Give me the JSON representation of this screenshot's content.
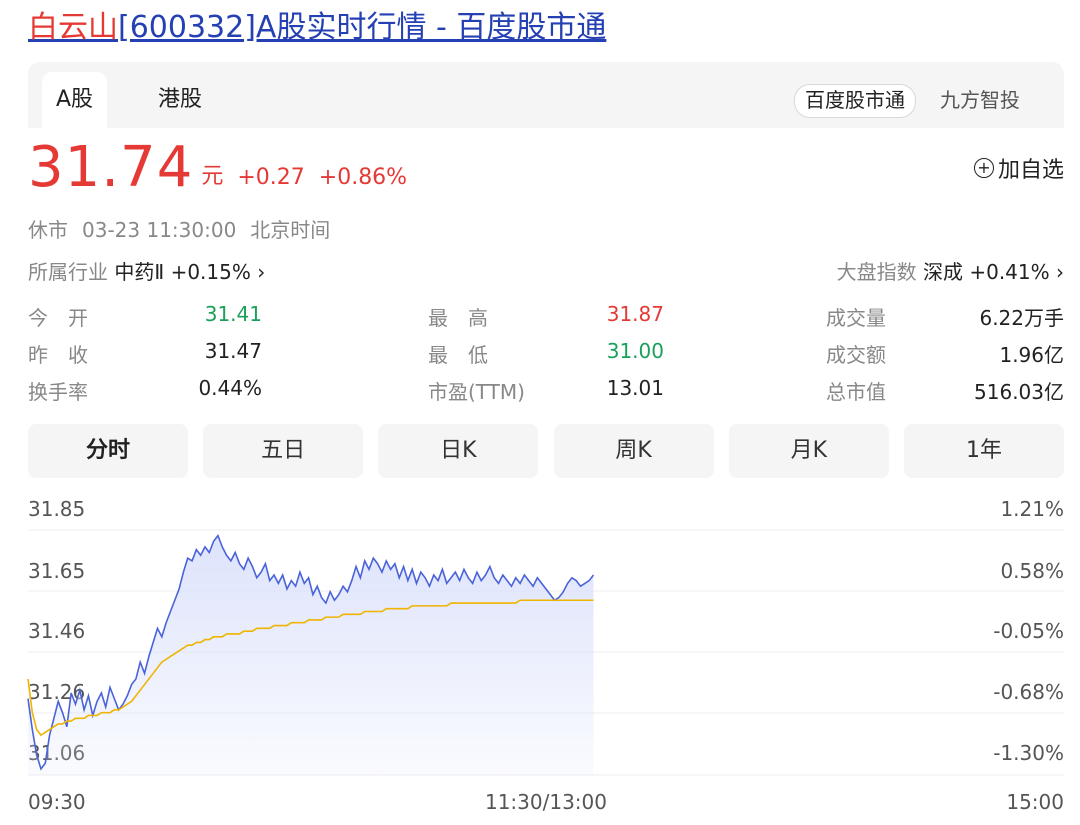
{
  "page": {
    "title_highlight": "白云山",
    "title_rest": "[600332]A股实时行情 - 百度股市通"
  },
  "tabs": {
    "a_share": "A股",
    "hk_share": "港股"
  },
  "sources": {
    "active": "百度股市通",
    "other": "九方智投"
  },
  "quote": {
    "price": "31.74",
    "unit": "元",
    "change": "+0.27",
    "change_pct": "+0.86%",
    "add_watchlist": "加自选",
    "status": "休市",
    "datetime": "03-23 11:30:00",
    "timezone": "北京时间"
  },
  "industry": {
    "label": "所属行业",
    "name": "中药Ⅱ",
    "change": "+0.15%",
    "arrow": "›"
  },
  "market_index": {
    "label": "大盘指数",
    "name": "深成",
    "change": "+0.41%",
    "arrow": "›"
  },
  "stats": [
    [
      {
        "label": "今　开",
        "value": "31.41",
        "color": "green"
      },
      {
        "label": "最　高",
        "value": "31.87",
        "color": "red"
      },
      {
        "label": "成交量",
        "value": "6.22万手",
        "color": "normal"
      }
    ],
    [
      {
        "label": "昨　收",
        "value": "31.47",
        "color": "normal"
      },
      {
        "label": "最　低",
        "value": "31.00",
        "color": "green"
      },
      {
        "label": "成交额",
        "value": "1.96亿",
        "color": "normal"
      }
    ],
    [
      {
        "label": "换手率",
        "value": "0.44%",
        "color": "normal"
      },
      {
        "label": "市盈(TTM)",
        "value": "13.01",
        "color": "normal"
      },
      {
        "label": "总市值",
        "value": "516.03亿",
        "color": "normal"
      }
    ]
  ],
  "period_tabs": [
    "分时",
    "五日",
    "日K",
    "周K",
    "月K",
    "1年"
  ],
  "active_period": 0,
  "colors": {
    "up": "#e53935",
    "down": "#1aa05a",
    "price_line": "#4a63d9",
    "avg_line": "#f0b400",
    "area_fill": "#dde3fb"
  },
  "chart_data": {
    "type": "line",
    "y_ticks": [
      "31.85",
      "31.65",
      "31.46",
      "31.26",
      "31.06"
    ],
    "y_pct_ticks": [
      "1.21%",
      "0.58%",
      "-0.05%",
      "-0.68%",
      "-1.30%"
    ],
    "x_ticks": [
      "09:30",
      "11:30/13:00",
      "15:00"
    ],
    "ylim": [
      31.06,
      31.85
    ],
    "minutes_total": 240,
    "series": [
      {
        "key": "price",
        "values": [
          31.25,
          31.14,
          31.05,
          31.0,
          31.02,
          31.12,
          31.18,
          31.24,
          31.2,
          31.15,
          31.27,
          31.23,
          31.28,
          31.21,
          31.26,
          31.19,
          31.24,
          31.27,
          31.22,
          31.29,
          31.25,
          31.21,
          31.23,
          31.26,
          31.3,
          31.32,
          31.38,
          31.34,
          31.4,
          31.45,
          31.5,
          31.47,
          31.52,
          31.56,
          31.6,
          31.64,
          31.7,
          31.75,
          31.74,
          31.78,
          31.76,
          31.79,
          31.77,
          31.81,
          31.83,
          31.79,
          31.76,
          31.74,
          31.77,
          31.73,
          31.71,
          31.75,
          31.72,
          31.68,
          31.7,
          31.73,
          31.67,
          31.69,
          31.66,
          31.69,
          31.64,
          31.67,
          31.65,
          31.7,
          31.66,
          31.68,
          31.62,
          31.65,
          31.61,
          31.59,
          31.63,
          31.6,
          31.62,
          31.65,
          31.63,
          31.67,
          31.72,
          31.68,
          31.74,
          31.71,
          31.75,
          31.73,
          31.7,
          31.74,
          31.71,
          31.73,
          31.68,
          31.72,
          31.67,
          31.71,
          31.66,
          31.7,
          31.68,
          31.65,
          31.69,
          31.67,
          31.71,
          31.66,
          31.68,
          31.7,
          31.67,
          31.71,
          31.68,
          31.66,
          31.7,
          31.67,
          31.69,
          31.72,
          31.68,
          31.66,
          31.69,
          31.67,
          31.65,
          31.68,
          31.66,
          31.69,
          31.67,
          31.65,
          31.68,
          31.66,
          31.64,
          31.62,
          31.6,
          31.61,
          31.63,
          31.66,
          31.68,
          31.67,
          31.65,
          31.66,
          31.67,
          31.69
        ]
      },
      {
        "key": "average",
        "values": [
          31.32,
          31.2,
          31.14,
          31.12,
          31.13,
          31.14,
          31.15,
          31.16,
          31.16,
          31.17,
          31.17,
          31.18,
          31.18,
          31.18,
          31.19,
          31.19,
          31.19,
          31.2,
          31.2,
          31.2,
          31.21,
          31.21,
          31.22,
          31.23,
          31.24,
          31.26,
          31.28,
          31.3,
          31.32,
          31.34,
          31.36,
          31.38,
          31.39,
          31.4,
          31.41,
          31.42,
          31.43,
          31.44,
          31.44,
          31.45,
          31.45,
          31.46,
          31.46,
          31.47,
          31.47,
          31.47,
          31.48,
          31.48,
          31.48,
          31.48,
          31.49,
          31.49,
          31.49,
          31.5,
          31.5,
          31.5,
          31.5,
          31.51,
          31.51,
          31.51,
          31.51,
          31.52,
          31.52,
          31.52,
          31.52,
          31.53,
          31.53,
          31.53,
          31.53,
          31.54,
          31.54,
          31.54,
          31.54,
          31.55,
          31.55,
          31.55,
          31.55,
          31.55,
          31.56,
          31.56,
          31.56,
          31.56,
          31.56,
          31.57,
          31.57,
          31.57,
          31.57,
          31.57,
          31.57,
          31.58,
          31.58,
          31.58,
          31.58,
          31.58,
          31.58,
          31.58,
          31.58,
          31.58,
          31.59,
          31.59,
          31.59,
          31.59,
          31.59,
          31.59,
          31.59,
          31.59,
          31.59,
          31.59,
          31.59,
          31.59,
          31.59,
          31.59,
          31.59,
          31.59,
          31.6,
          31.6,
          31.6,
          31.6,
          31.6,
          31.6,
          31.6,
          31.6,
          31.6,
          31.6,
          31.6,
          31.6,
          31.6,
          31.6,
          31.6,
          31.6,
          31.6,
          31.6
        ]
      }
    ]
  }
}
